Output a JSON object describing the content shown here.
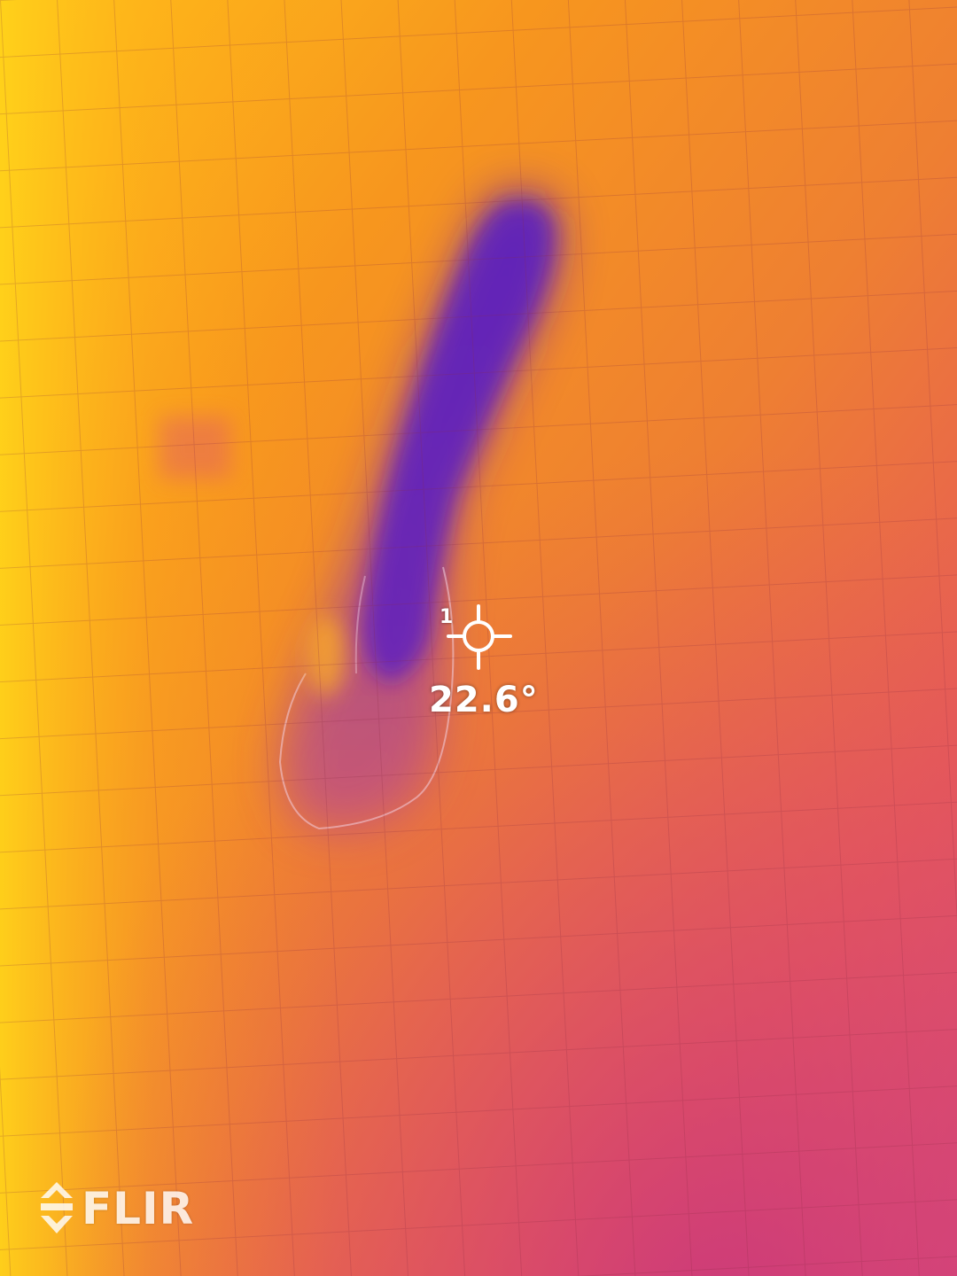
{
  "spot_meter": {
    "index": "1",
    "reading": "22.6°"
  },
  "brand": {
    "logo_text": "FLIR"
  },
  "palette": {
    "hot": "#ffcf12",
    "warm": "#f38a24",
    "mid": "#ea6a3a",
    "cool": "#d8487a",
    "cold": "#5a1ac8"
  }
}
